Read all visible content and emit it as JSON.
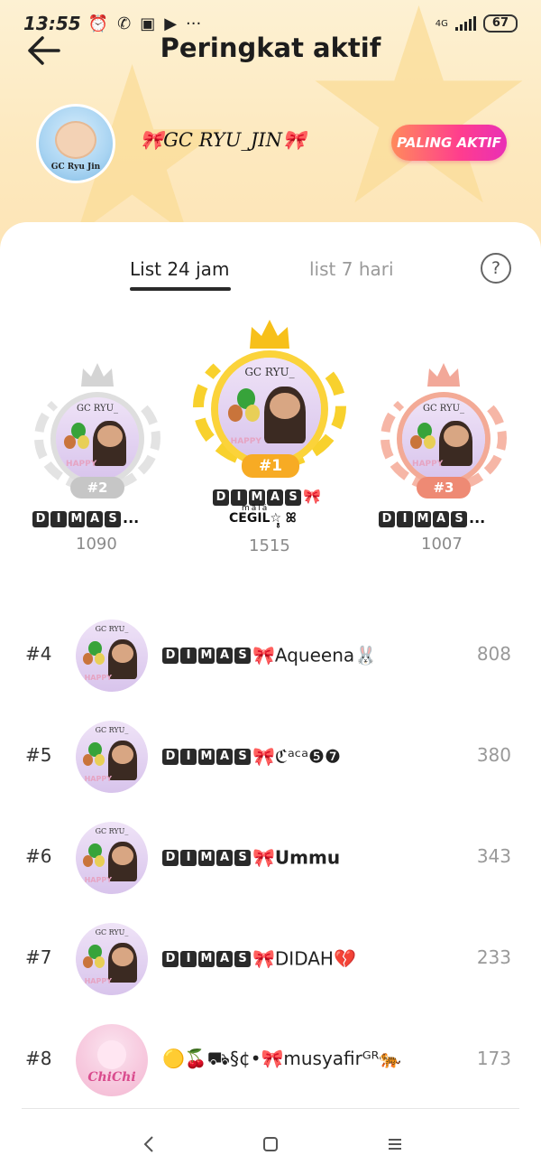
{
  "status_bar": {
    "time": "13:55",
    "left_icons": [
      "alarm-icon",
      "whatsapp-icon",
      "message-icon",
      "play-icon",
      "more-icon"
    ],
    "more_text": "···",
    "network": "4G",
    "battery": "67"
  },
  "header": {
    "title": "Peringkat aktif",
    "back_icon": "arrow-left-icon"
  },
  "group": {
    "name": "🎀GC RYU_JIN🎀",
    "avatar_caption": "GC Ryu Jin",
    "badge": "PALING AKTIF",
    "badge_colors": [
      "#ff8a5c",
      "#ff3d8e",
      "#e92fb6"
    ]
  },
  "tabs": [
    {
      "label": "List 24 jam",
      "active": true
    },
    {
      "label": "list 7 hari",
      "active": false
    }
  ],
  "help_label": "?",
  "photo_caption": "GC RYU_",
  "photo_caption_bottom": "HAPPY",
  "podium": [
    {
      "rank": "#2",
      "name_letters": [
        "D",
        "I",
        "M",
        "A",
        "S"
      ],
      "name_suffix": "...",
      "score": "1090",
      "color": "#c8c8c8"
    },
    {
      "rank": "#1",
      "name_letters": [
        "D",
        "I",
        "M",
        "A",
        "S"
      ],
      "name_suffix": "🎀",
      "name_line2": "CEGIL",
      "name_superscript": "mälä",
      "name_line2_suffix": "☆̣̥ ꕤ",
      "score": "1515",
      "color": "#f5c518"
    },
    {
      "rank": "#3",
      "name_letters": [
        "D",
        "I",
        "M",
        "A",
        "S"
      ],
      "name_suffix": "...",
      "score": "1007",
      "color": "#f0a090"
    }
  ],
  "list": [
    {
      "rank": "#4",
      "letters": [
        "D",
        "I",
        "M",
        "A",
        "S"
      ],
      "suffix": "🎀Aqueena🐰",
      "score": "808",
      "avatar": "boy"
    },
    {
      "rank": "#5",
      "letters": [
        "D",
        "I",
        "M",
        "A",
        "S"
      ],
      "suffix": "🎀ℭᵃᶜᵃ❺❼",
      "score": "380",
      "avatar": "boy"
    },
    {
      "rank": "#6",
      "letters": [
        "D",
        "I",
        "M",
        "A",
        "S"
      ],
      "suffix": "🎀Ummu",
      "score": "343",
      "avatar": "boy"
    },
    {
      "rank": "#7",
      "letters": [
        "D",
        "I",
        "M",
        "A",
        "S"
      ],
      "suffix": "🎀DIDAH💔",
      "score": "233",
      "avatar": "boy"
    },
    {
      "rank": "#8",
      "letters": [],
      "suffix": "🟡🍒⛟§¢•🎀musyafirᴳᴿ🐅",
      "score": "173",
      "avatar": "pink",
      "avatar_caption": "ChiChi"
    }
  ],
  "nav": {
    "back": "nav-back-icon",
    "home": "nav-home-icon",
    "menu": "nav-menu-icon"
  }
}
